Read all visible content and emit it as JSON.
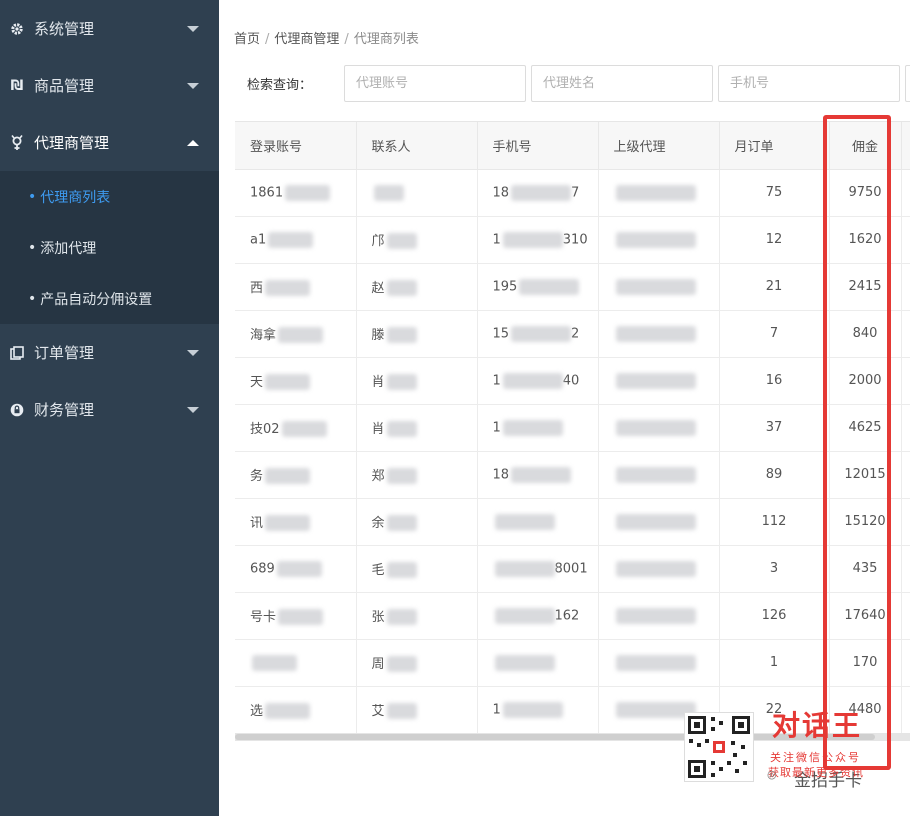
{
  "sidebar": {
    "items": [
      {
        "label": "系统管理",
        "icon": "gear-icon",
        "expanded": false
      },
      {
        "label": "商品管理",
        "icon": "product-icon",
        "expanded": false
      },
      {
        "label": "代理商管理",
        "icon": "agent-icon",
        "expanded": true,
        "children": [
          {
            "label": "代理商列表",
            "current": true
          },
          {
            "label": "添加代理",
            "current": false
          },
          {
            "label": "产品自动分佣设置",
            "current": false
          }
        ]
      },
      {
        "label": "订单管理",
        "icon": "order-icon",
        "expanded": false
      },
      {
        "label": "财务管理",
        "icon": "finance-icon",
        "expanded": false
      }
    ]
  },
  "breadcrumb": {
    "home": "首页",
    "section": "代理商管理",
    "page": "代理商列表",
    "sep": "/"
  },
  "search": {
    "label": "检索查询：",
    "account_placeholder": "代理账号",
    "name_placeholder": "代理姓名",
    "phone_placeholder": "手机号"
  },
  "table": {
    "headers": [
      "登录账号",
      "联系人",
      "手机号",
      "上级代理",
      "月订单",
      "佣金"
    ],
    "rows": [
      {
        "account": "1861",
        "contact": "",
        "phone_prefix": "18",
        "phone_suffix": "7",
        "orders": "75",
        "commission": "9750"
      },
      {
        "account": "a1",
        "contact": "邝",
        "phone_prefix": "1",
        "phone_suffix": "310",
        "orders": "12",
        "commission": "1620"
      },
      {
        "account": "西",
        "contact": "赵",
        "phone_prefix": "195",
        "phone_suffix": "",
        "orders": "21",
        "commission": "2415"
      },
      {
        "account": "海拿",
        "contact": "滕",
        "phone_prefix": "15",
        "phone_suffix": "2",
        "orders": "7",
        "commission": "840"
      },
      {
        "account": "天",
        "contact": "肖",
        "phone_prefix": "1",
        "phone_suffix": "40",
        "orders": "16",
        "commission": "2000"
      },
      {
        "account": "技02",
        "contact": "肖",
        "phone_prefix": "1",
        "phone_suffix": "",
        "orders": "37",
        "commission": "4625"
      },
      {
        "account": "务",
        "contact": "郑",
        "phone_prefix": "18",
        "phone_suffix": "",
        "orders": "89",
        "commission": "12015"
      },
      {
        "account": "讯",
        "contact": "余",
        "phone_prefix": "",
        "phone_suffix": "",
        "orders": "112",
        "commission": "15120"
      },
      {
        "account": "689",
        "contact": "毛",
        "phone_prefix": "",
        "phone_suffix": "8001",
        "orders": "3",
        "commission": "435"
      },
      {
        "account": "号卡",
        "contact": "张",
        "phone_prefix": "",
        "phone_suffix": "162",
        "orders": "126",
        "commission": "17640"
      },
      {
        "account": "",
        "contact": "周",
        "phone_prefix": "",
        "phone_suffix": "",
        "orders": "1",
        "commission": "170"
      },
      {
        "account": "选",
        "contact": "艾",
        "phone_prefix": "1",
        "phone_suffix": "",
        "orders": "22",
        "commission": "4480"
      }
    ]
  },
  "watermark": {
    "title": "对话王",
    "line1": "关注微信公众号",
    "line2": "获取最新更多资讯",
    "sign": "金招手卡"
  },
  "colors": {
    "sidebar_bg": "#2f4050",
    "accent": "#3e9bf0",
    "highlight": "#e53935"
  }
}
